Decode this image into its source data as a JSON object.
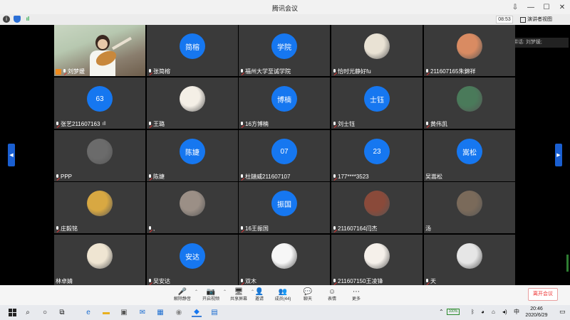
{
  "window": {
    "title": "腾讯会议",
    "controls": [
      "⇩",
      "—",
      "☐",
      "✕"
    ]
  },
  "infobar": {
    "timer": "08:53",
    "view_label": "演讲者视图"
  },
  "speaking": {
    "text": "正在讲话: 刘梦媛;"
  },
  "tiles": [
    {
      "kind": "video",
      "name": "刘梦媛"
    },
    {
      "kind": "blue",
      "avatar_text": "简榕",
      "name": "张简榕"
    },
    {
      "kind": "blue",
      "avatar_text": "学院",
      "name": "福州大学至诚学院"
    },
    {
      "kind": "photo",
      "name": "恰时光静好fu",
      "color": "#e9e2d4"
    },
    {
      "kind": "photo",
      "name": "211607165朱錦祥",
      "color": "#d98b62"
    },
    {
      "kind": "blue",
      "avatar_text": "63",
      "name": "张艺211607163",
      "signal": true
    },
    {
      "kind": "photo",
      "name": "王璐",
      "color": "#f4efe6"
    },
    {
      "kind": "blue",
      "avatar_text": "博楠",
      "name": "16方博楠"
    },
    {
      "kind": "blue",
      "avatar_text": "士钰",
      "name": "刘士钰"
    },
    {
      "kind": "photo",
      "name": "黄伟凯",
      "color": "#4a7a5a"
    },
    {
      "kind": "photo",
      "name": "PPP",
      "color": "#6b6b6b"
    },
    {
      "kind": "blue",
      "avatar_text": "陈婕",
      "name": "陈婕"
    },
    {
      "kind": "blue",
      "avatar_text": "07",
      "name": "杜鏈威211607107"
    },
    {
      "kind": "blue",
      "avatar_text": "23",
      "name": "177****3523"
    },
    {
      "kind": "blue",
      "avatar_text": "嵩松",
      "name": "吴嵩松",
      "no_mic": true
    },
    {
      "kind": "photo",
      "name": "庄毅铭",
      "color": "#d8a842"
    },
    {
      "kind": "photo",
      "name": ",",
      "color": "#9b8f86"
    },
    {
      "kind": "blue",
      "avatar_text": "振国",
      "name": "16王振国"
    },
    {
      "kind": "photo",
      "name": "211607164闫杰",
      "color": "#8a4a3a"
    },
    {
      "kind": "photo",
      "name": "汤",
      "color": "#7a6a5a",
      "no_mic": true
    },
    {
      "kind": "photo",
      "name": "林卓婧",
      "color": "#efe5d2",
      "no_mic": true
    },
    {
      "kind": "blue",
      "avatar_text": "安达",
      "name": "吴安达"
    },
    {
      "kind": "photo",
      "name": "双木",
      "color": "#f7f7f7"
    },
    {
      "kind": "photo",
      "name": "211607150王凌锋",
      "color": "#f5f0ea"
    },
    {
      "kind": "photo",
      "name": "天",
      "color": "#e6e6e6"
    }
  ],
  "toolbar": {
    "items": [
      {
        "label": "解除静音",
        "icon": "🎤"
      },
      {
        "label": "开启视频",
        "icon": "📷"
      },
      {
        "label": "共享屏幕",
        "icon": "🖥"
      },
      {
        "label": "邀请",
        "icon": "👤"
      },
      {
        "label": "成员(44)",
        "icon": "👥"
      },
      {
        "label": "聊天",
        "icon": "💬"
      },
      {
        "label": "表情",
        "icon": "☺"
      },
      {
        "label": "更多",
        "icon": "⋯"
      }
    ],
    "leave_label": "离开会议"
  },
  "taskbar": {
    "battery": "100%",
    "ime": "中",
    "time": "20:46",
    "date": "2020/6/29",
    "notif_count": "2"
  }
}
